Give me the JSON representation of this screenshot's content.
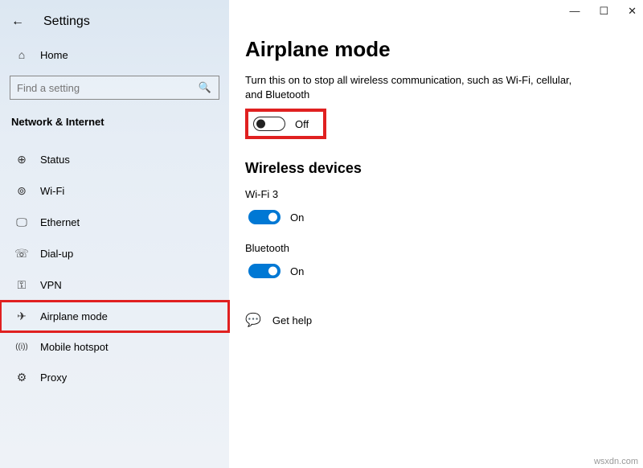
{
  "window": {
    "title": "Settings",
    "minimize": "—",
    "maximize": "☐",
    "close": "✕"
  },
  "sidebar": {
    "home": "Home",
    "search_placeholder": "Find a setting",
    "category": "Network & Internet",
    "items": [
      {
        "icon": "⊕",
        "label": "Status"
      },
      {
        "icon": "⊚",
        "label": "Wi-Fi"
      },
      {
        "icon": "🖵",
        "label": "Ethernet"
      },
      {
        "icon": "☏",
        "label": "Dial-up"
      },
      {
        "icon": "⚿",
        "label": "VPN"
      },
      {
        "icon": "✈",
        "label": "Airplane mode"
      },
      {
        "icon": "((i))",
        "label": "Mobile hotspot"
      },
      {
        "icon": "⚙",
        "label": "Proxy"
      }
    ]
  },
  "main": {
    "title": "Airplane mode",
    "desc": "Turn this on to stop all wireless communication, such as Wi-Fi, cellular, and Bluetooth",
    "airplane_state": "Off",
    "section_wireless": "Wireless devices",
    "devices": [
      {
        "name": "Wi-Fi 3",
        "state": "On"
      },
      {
        "name": "Bluetooth",
        "state": "On"
      }
    ],
    "help": "Get help"
  },
  "watermark": "wsxdn.com"
}
